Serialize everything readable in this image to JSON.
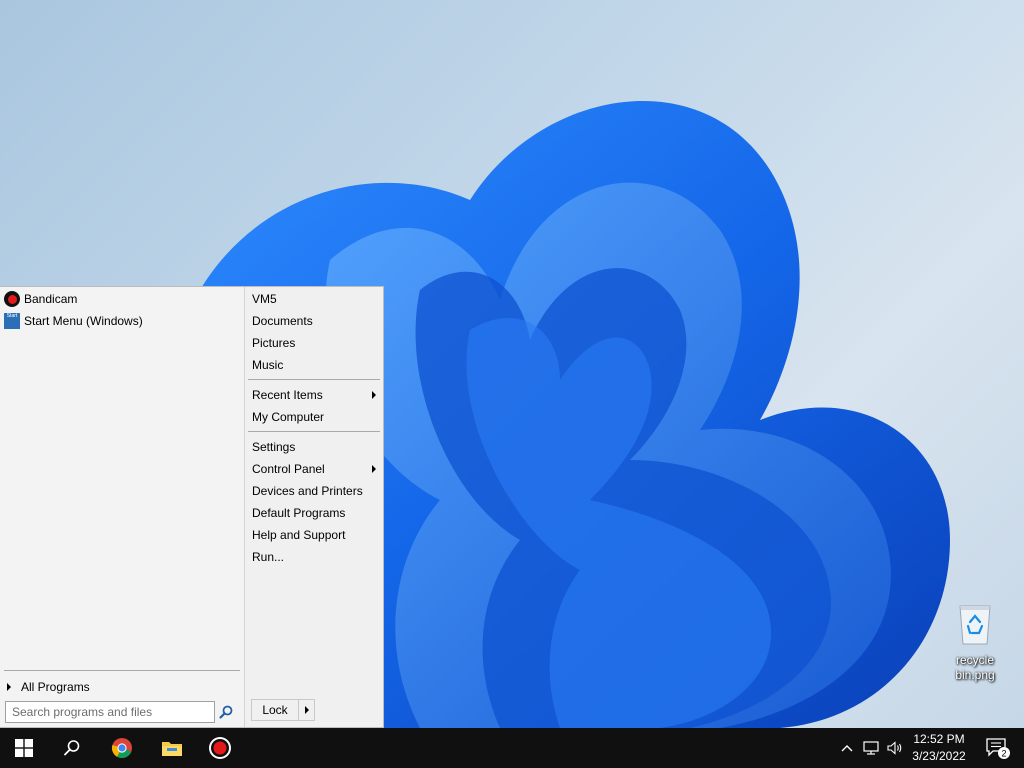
{
  "start_menu": {
    "programs": [
      {
        "label": "Bandicam",
        "icon": "bandicam-icon"
      },
      {
        "label": "Start Menu (Windows)",
        "icon": "start-menu-app-icon"
      }
    ],
    "start_icon_text": "Start",
    "all_programs_label": "All Programs",
    "search_placeholder": "Search programs and files",
    "right_items": [
      {
        "label": "VM5"
      },
      {
        "label": "Documents"
      },
      {
        "label": "Pictures"
      },
      {
        "label": "Music"
      },
      {
        "label": "Recent Items",
        "submenu": true
      },
      {
        "label": "My Computer"
      },
      {
        "label": "Settings"
      },
      {
        "label": "Control Panel",
        "submenu": true
      },
      {
        "label": "Devices and Printers"
      },
      {
        "label": "Default Programs"
      },
      {
        "label": "Help and Support"
      },
      {
        "label": "Run..."
      }
    ],
    "lock_label": "Lock"
  },
  "desktop": {
    "icons": [
      {
        "label": "recycle bin.png",
        "icon": "recycle-bin-icon"
      }
    ]
  },
  "taskbar": {
    "buttons": [
      "windows-start-icon",
      "search-icon",
      "chrome-icon",
      "file-explorer-icon",
      "bandicam-record-icon"
    ],
    "tray_icons": [
      "chevron-up-icon",
      "network-icon",
      "volume-icon"
    ],
    "time": "12:52 PM",
    "date": "3/23/2022",
    "notification_count": "2"
  },
  "colors": {
    "taskbar": "#101010",
    "menu_background": "#f0f0f0",
    "wallpaper_accent": "#1565e0"
  }
}
